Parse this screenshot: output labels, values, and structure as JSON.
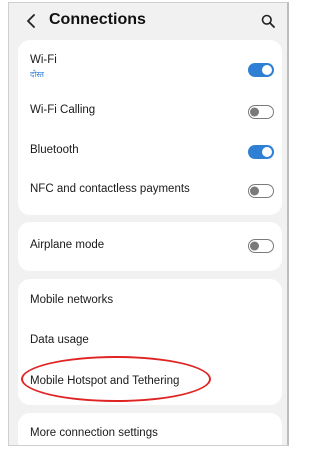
{
  "header": {
    "back_icon": "chevron-left-icon",
    "title": "Connections",
    "search_icon": "search-icon"
  },
  "colors": {
    "accent": "#2f7fd4",
    "highlight": "#e02424",
    "background": "#f1f1f1"
  },
  "group1": {
    "wifi": {
      "label": "Wi-Fi",
      "sublabel": "दोस्त",
      "enabled": true
    },
    "wifi_calling": {
      "label": "Wi-Fi Calling",
      "enabled": false
    },
    "bluetooth": {
      "label": "Bluetooth",
      "enabled": true
    },
    "nfc": {
      "label": "NFC and contactless payments",
      "enabled": false
    }
  },
  "group2": {
    "airplane": {
      "label": "Airplane mode",
      "enabled": false
    }
  },
  "group3": {
    "mobile_networks": {
      "label": "Mobile networks"
    },
    "data_usage": {
      "label": "Data usage"
    },
    "hotspot": {
      "label": "Mobile Hotspot and Tethering"
    }
  },
  "group4": {
    "more": {
      "label": "More connection settings"
    }
  }
}
